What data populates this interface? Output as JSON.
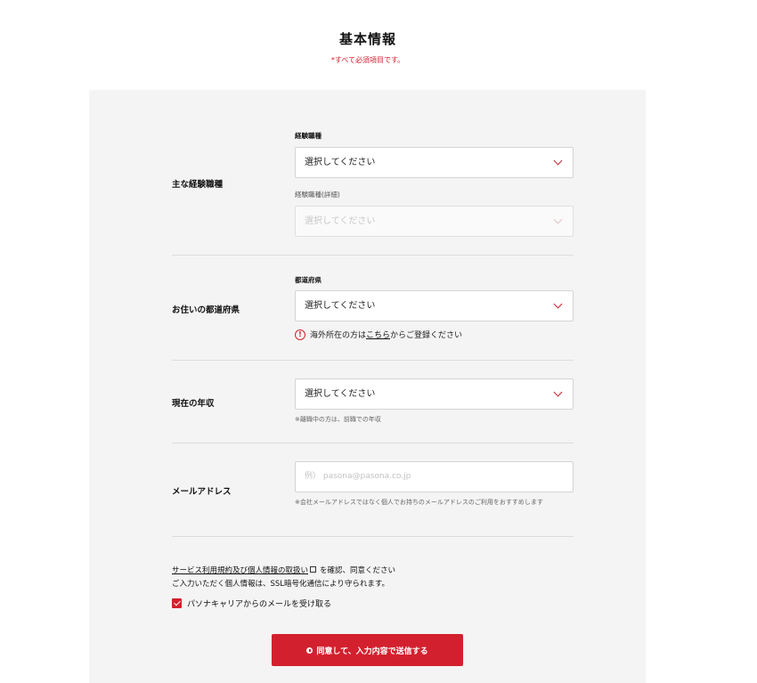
{
  "header": {
    "title": "基本情報",
    "required_note": "*すべて必須項目です。"
  },
  "experience": {
    "label": "主な経験職種",
    "category_label": "経験職種",
    "category_value": "選択してください",
    "detail_label": "経験職種(詳細)",
    "detail_value": "選択してください"
  },
  "prefecture": {
    "label": "お住いの都道府県",
    "sub_label": "都道府県",
    "value": "選択してください",
    "notice_before": "海外所在の方は",
    "notice_link": "こちら",
    "notice_after": "からご登録ください",
    "notice_icon_glyph": "!"
  },
  "income": {
    "label": "現在の年収",
    "value": "選択してください",
    "hint": "※離職中の方は、前職での年収"
  },
  "email": {
    "label": "メールアドレス",
    "placeholder": "例） pasona@pasona.co.jp",
    "hint": "※会社メールアドレスではなく個人でお持ちのメールアドレスのご利用をおすすめします"
  },
  "terms": {
    "link_text": "サービス利用規約及び個人情報の取扱い",
    "after_link": "を確認、同意ください",
    "ssl_note": "ご入力いただく個人情報は、SSL暗号化通信により守られます。"
  },
  "opt_in": {
    "label": "パソナキャリアからのメールを受け取る",
    "checked": true
  },
  "submit": {
    "label": "同意して、入力内容で送信する"
  },
  "colors": {
    "accent": "#d3202e",
    "panel": "#f4f4f4"
  }
}
